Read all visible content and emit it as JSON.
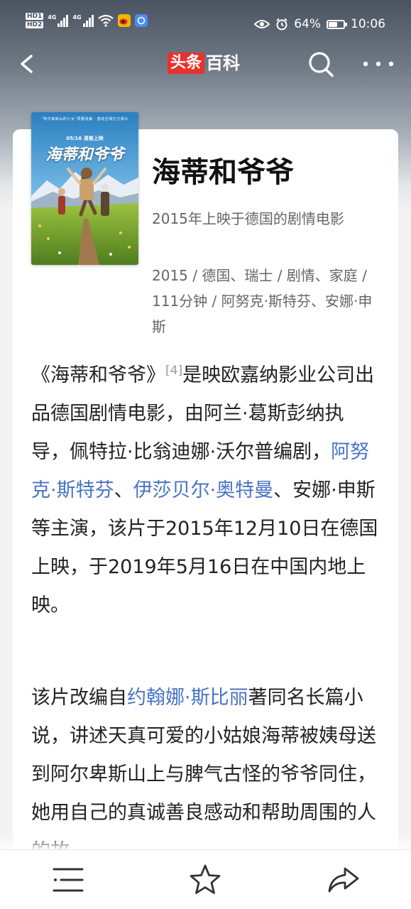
{
  "status_bar": {
    "hd_label": "HD",
    "hd_1": "1",
    "hd_2": "2",
    "network_1": "4G",
    "network_2": "4G",
    "battery_percent": "64%",
    "battery_level": 0.64,
    "time": "10:06",
    "icons": [
      "hd-icon",
      "signal-icon",
      "wifi-icon",
      "weibo-icon",
      "app-icon",
      "eye-icon",
      "alarm-icon",
      "battery-icon"
    ]
  },
  "nav": {
    "logo_part_1": "头条",
    "logo_part_2": "百科",
    "logo_color": "#e8322c",
    "icons": [
      "back-arrow-icon",
      "search-icon",
      "more-dots-icon"
    ]
  },
  "entry": {
    "title": "海蒂和爷爷",
    "subtitle": "2015年上映于德国的剧情电影",
    "meta": "2015 / 德国、瑞士 / 剧情、家庭 / 111分钟 / 阿努克·斯特芬、安娜·申斯"
  },
  "poster": {
    "tagline": "“阿尔卑斯山的少女”原著改编 · 感动全球亿万观众",
    "date": "05/16  清美上映",
    "title": "海蒂和爷爷"
  },
  "para1": {
    "t1": "《海蒂和爷爷》",
    "cite": "[4]",
    "t2": "是映欧嘉纳影业公司出品德国剧情电影，由阿兰·葛斯彭纳执导，佩特拉·比翁迪娜·沃尔普编剧，",
    "link1": "阿努克·斯特芬",
    "sep": "、",
    "link2": "伊莎贝尔·奥特曼",
    "t3": "、安娜·申斯等主演，该片于2015年12月10日在德国上映，于2019年5月16日在中国内地上映。"
  },
  "para2": {
    "t1": "该片改编自",
    "link": "约翰娜·斯比丽",
    "t2": "著同名长篇小说，讲述天真可爱的小姑娘海蒂被姨母送到阿尔卑斯山上与脾气古怪的爷爷同住，她用自己的真诚善良感动和帮助周围的人的故"
  },
  "toolbar": {
    "icons": [
      "menu-list-icon",
      "star-icon",
      "share-icon"
    ]
  },
  "colors": {
    "link": "#4873c3",
    "text": "#222222",
    "secondary": "#666666"
  }
}
